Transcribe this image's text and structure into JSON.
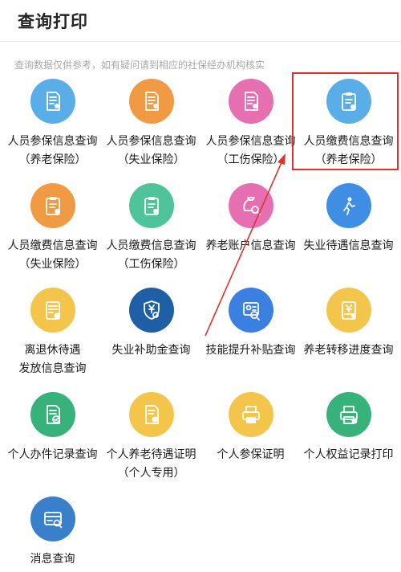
{
  "header": {
    "title": "查询打印"
  },
  "notice": "查询数据仅供参考，如有疑问请到相应的社保经办机构核实",
  "items": [
    {
      "line1": "人员参保信息查询",
      "line2": "（养老保险）",
      "icon": "insured-info-document-icon",
      "color": "#5aaee7"
    },
    {
      "line1": "人员参保信息查询",
      "line2": "（失业保险）",
      "icon": "insured-info-document-icon",
      "color": "#f19a44"
    },
    {
      "line1": "人员参保信息查询",
      "line2": "（工伤保险）",
      "icon": "insured-info-document-icon",
      "color": "#e56fb1"
    },
    {
      "line1": "人员缴费信息查询",
      "line2": "（养老保险）",
      "icon": "payment-clipboard-icon",
      "color": "#5aaee7"
    },
    {
      "line1": "人员缴费信息查询",
      "line2": "（失业保险）",
      "icon": "payment-clipboard-icon",
      "color": "#f19a44"
    },
    {
      "line1": "人员缴费信息查询",
      "line2": "（工伤保险）",
      "icon": "payment-clipboard-icon",
      "color": "#4fc49a"
    },
    {
      "line1": "养老账户信息查询",
      "line2": "",
      "icon": "money-bag-search-icon",
      "color": "#e56fb1"
    },
    {
      "line1": "失业待遇信息查询",
      "line2": "",
      "icon": "walking-person-icon",
      "color": "#3e8ee4"
    },
    {
      "line1": "离退休待遇",
      "line2": "发放信息查询",
      "icon": "pension-document-icon",
      "color": "#f3c64b"
    },
    {
      "line1": "失业补助金查询",
      "line2": "",
      "icon": "shield-yuan-search-icon",
      "color": "#1f5fa5"
    },
    {
      "line1": "技能提升补贴查询",
      "line2": "",
      "icon": "certificate-search-icon",
      "color": "#3b7fe0"
    },
    {
      "line1": "养老转移进度查询",
      "line2": "",
      "icon": "transfer-progress-icon",
      "color": "#f3c64b"
    },
    {
      "line1": "个人办件记录查询",
      "line2": "",
      "icon": "record-document-check-icon",
      "color": "#36b27a"
    },
    {
      "line1": "个人养老待遇证明",
      "line2": "（个人专用）",
      "icon": "pension-certificate-icon",
      "color": "#f3c64b"
    },
    {
      "line1": "个人参保证明",
      "line2": "",
      "icon": "printer-icon",
      "color": "#f3c64b"
    },
    {
      "line1": "个人权益记录打印",
      "line2": "",
      "icon": "printer-upload-icon",
      "color": "#36b27a"
    },
    {
      "line1": "消息查询",
      "line2": "",
      "icon": "message-card-search-icon",
      "color": "#3a7fc9"
    }
  ],
  "annotation": {
    "highlight_color": "#e0312c",
    "highlighted_item": "人员缴费信息查询（养老保险）"
  }
}
